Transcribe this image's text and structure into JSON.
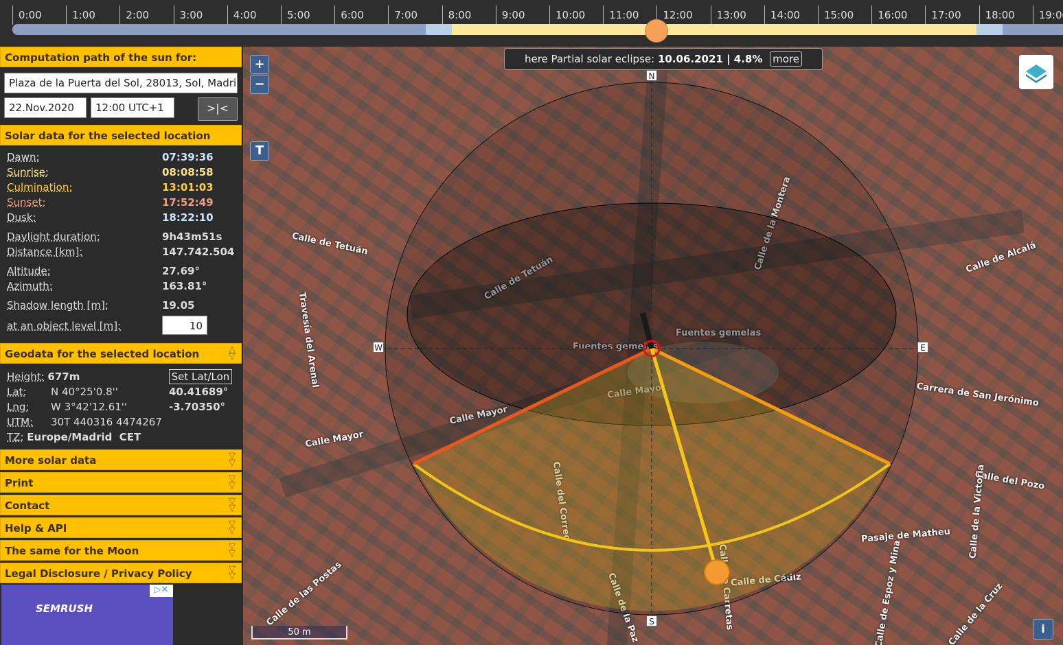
{
  "timeline": {
    "hours": [
      "0:00",
      "1:00",
      "2:00",
      "3:00",
      "4:00",
      "5:00",
      "6:00",
      "7:00",
      "8:00",
      "9:00",
      "10:00",
      "11:00",
      "12:00",
      "13:00",
      "14:00",
      "15:00",
      "16:00",
      "17:00",
      "18:00",
      "19:00"
    ],
    "current_hour": 12.0,
    "colors": {
      "night": "#8f9fc4",
      "twilight": "#b9d0e6",
      "day": "#fde79a",
      "sun": "#f6a25a"
    }
  },
  "sidebar": {
    "path_header": "Computation path of the sun for:",
    "address": "Plaza de la Puerta del Sol, 28013, Sol, Madrid",
    "date": "22.Nov.2020",
    "time": "12:00 UTC+1",
    "go_label": ">|<",
    "solar_header": "Solar data for the selected location",
    "solar": {
      "dawn_label": "Dawn:",
      "dawn": "07:39:36",
      "sunrise_label": "Sunrise:",
      "sunrise": "08:08:58",
      "culmination_label": "Culmination:",
      "culmination": "13:01:03",
      "sunset_label": "Sunset:",
      "sunset": "17:52:49",
      "dusk_label": "Dusk:",
      "dusk": "18:22:10",
      "daylight_label": "Daylight duration:",
      "daylight": "9h43m51s",
      "distance_label": "Distance [km]:",
      "distance": "147.742.504",
      "altitude_label": "Altitude:",
      "altitude": "27.69°",
      "azimuth_label": "Azimuth:",
      "azimuth": "163.81°",
      "shadow_label": "Shadow length [m]:",
      "shadow": "19.05",
      "object_label": "at an object level [m]:",
      "object_level": "10"
    },
    "geo_header": "Geodata for the selected location",
    "geo": {
      "height_label": "Height:",
      "height": "677m",
      "set_latlon": "Set Lat/Lon",
      "lat_label": "Lat:",
      "lat_dms": "N 40°25'0.8''",
      "lat_dec": "40.41689°",
      "lng_label": "Lng:",
      "lng_dms": "W 3°42'12.61''",
      "lng_dec": "-3.70350°",
      "utm_label": "UTM:",
      "utm": "30T 440316 4474267",
      "tz_label": "TZ:",
      "tz": "Europe/Madrid  CET"
    },
    "sections": [
      "More solar data",
      "Print",
      "Contact",
      "Help & API",
      "The same for the Moon",
      "Legal Disclosure / Privacy Policy"
    ],
    "ad_brand": "SEMRUSH"
  },
  "map": {
    "eclipse_prefix": "here Partial solar eclipse:",
    "eclipse_value": "10.06.2021 | 4.8%",
    "eclipse_more": "more",
    "compass": {
      "n": "N",
      "s": "S",
      "e": "E",
      "w": "W"
    },
    "scale": "50 m",
    "zoom_in": "+",
    "zoom_out": "−",
    "terrain": "T",
    "info": "i",
    "streets": [
      "Calle de Tetuán",
      "Calle de Tetuán",
      "Calle de la Montera",
      "Calle de Alcalá",
      "Calle Mayor",
      "Calle Mayor",
      "Calle Mayor",
      "Carrera de San Jerónimo",
      "Calle del Pozo",
      "Calle del Correo",
      "Calle de Cádiz",
      "Pasaje de Matheu",
      "Travesía del Arenal",
      "Calle de las Postas",
      "Fuentes gemelas",
      "Fuentes gemelas",
      "Calle de Carretas",
      "Calle de la Victoria",
      "Calle de la Cruz",
      "Calle de la Paz",
      "Calle de Espoz y Mina"
    ],
    "sun_colors": {
      "sunrise_line": "#e8581e",
      "sunset_line": "#f39c12",
      "noon_line": "#f5c518",
      "path": "#f0c419"
    }
  }
}
